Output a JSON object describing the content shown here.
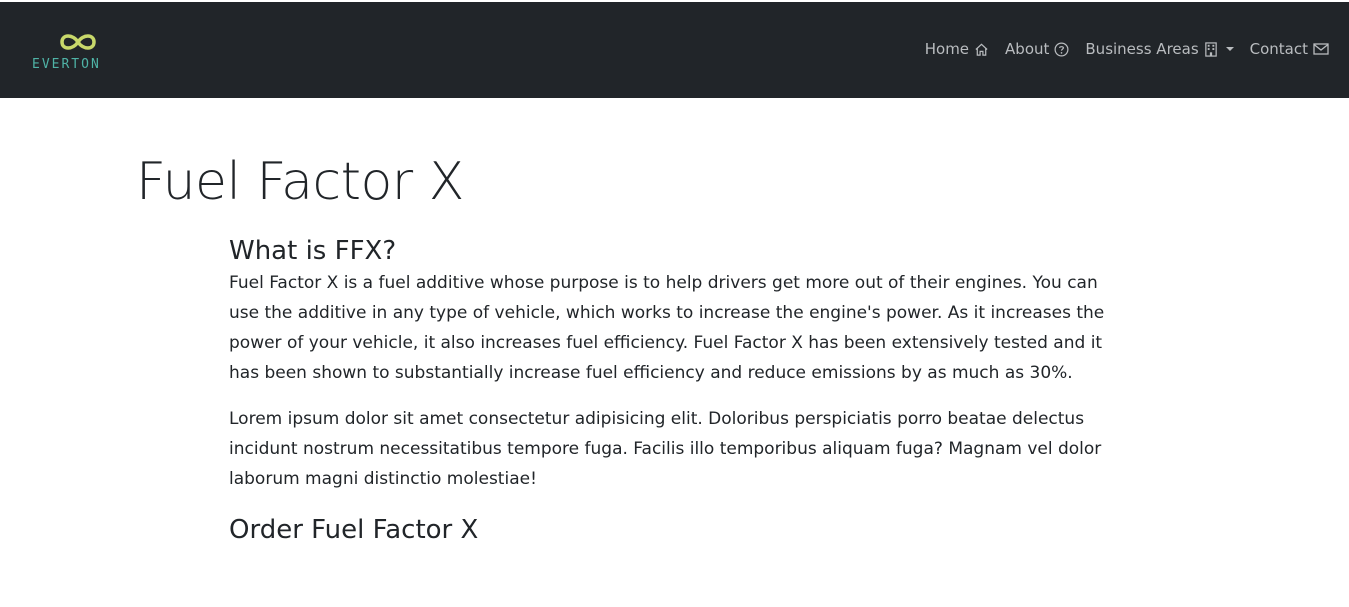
{
  "navbar": {
    "brand": "EVERTON",
    "links": [
      {
        "label": "Home",
        "icon": "house-icon"
      },
      {
        "label": "About",
        "icon": "question-circle-icon"
      },
      {
        "label": "Business Areas",
        "icon": "building-icon"
      },
      {
        "label": "Contact",
        "icon": "envelope-icon"
      }
    ]
  },
  "page": {
    "title": "Fuel Factor X",
    "sections": [
      {
        "heading": "What is FFX?"
      },
      {
        "heading": "Order Fuel Factor X"
      }
    ],
    "paragraphs": [
      "Fuel Factor X is a fuel additive whose purpose is to help drivers get more out of their engines. You can use the additive in any type of vehicle, which works to increase the engine's power. As it increases the power of your vehicle, it also increases fuel efficiency. Fuel Factor X has been extensively tested and it has been shown to substantially increase fuel efficiency and reduce emissions by as much as 30%.",
      "Lorem ipsum dolor sit amet consectetur adipisicing elit. Doloribus perspiciatis porro beatae delectus incidunt nostrum necessitatibus tempore fuga. Facilis illo temporibus aliquam fuga? Magnam vel dolor laborum magni distinctio molestiae!"
    ]
  },
  "colors": {
    "navbar_bg": "#212529",
    "nav_text": "#b9bcbf",
    "logo_yellow": "#c8d86a",
    "logo_teal": "#4fb3a6",
    "body_text": "#212529"
  }
}
